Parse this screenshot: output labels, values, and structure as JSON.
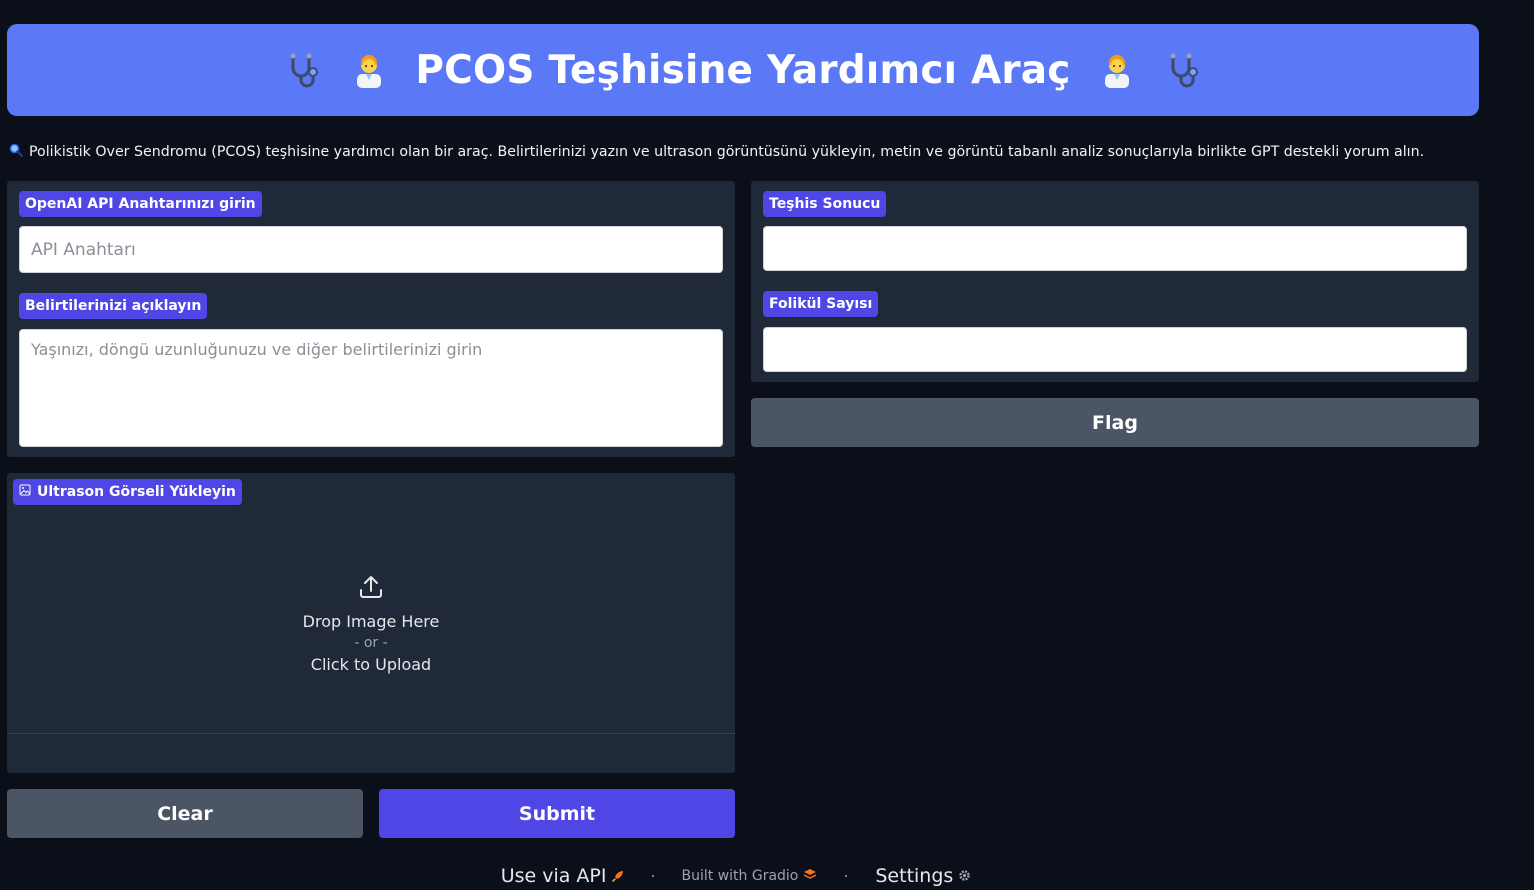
{
  "header": {
    "title": "PCOS Teşhisine Yardımcı Araç",
    "icons": [
      "stethoscope-icon",
      "health-worker-icon",
      "health-worker-icon",
      "stethoscope-icon"
    ]
  },
  "description": {
    "icon": "magnifier-icon",
    "text": "Polikistik Over Sendromu (PCOS) teşhisine yardımcı olan bir araç. Belirtilerinizi yazın ve ultrason görüntüsünü yükleyin, metin ve görüntü tabanlı analiz sonuçlarıyla birlikte GPT destekli yorum alın."
  },
  "inputs": {
    "api_key": {
      "label": "OpenAI API Anahtarınızı girin",
      "placeholder": "API Anahtarı",
      "value": ""
    },
    "symptoms": {
      "label": "Belirtilerinizi açıklayın",
      "placeholder": "Yaşınızı, döngü uzunluğunuzu ve diğer belirtilerinizi girin",
      "value": ""
    },
    "image": {
      "label": "Ultrason Görseli Yükleyin",
      "label_icon": "image-icon",
      "upload_icon": "upload-icon",
      "drop_text": "Drop Image Here",
      "or_text": "- or -",
      "click_text": "Click to Upload"
    }
  },
  "outputs": {
    "diagnosis": {
      "label": "Teşhis Sonucu",
      "value": ""
    },
    "follicle_count": {
      "label": "Folikül Sayısı",
      "value": ""
    }
  },
  "buttons": {
    "clear": "Clear",
    "submit": "Submit",
    "flag": "Flag"
  },
  "footer": {
    "api": "Use via API",
    "api_icon": "rocket-icon",
    "built_with": "Built with Gradio",
    "gradio_icon": "gradio-logo-icon",
    "settings": "Settings",
    "settings_icon": "gear-icon"
  },
  "colors": {
    "background": "#0b0f19",
    "header": "#5b78f6",
    "panel": "#1f2937",
    "accent": "#4f46e5",
    "secondary_button": "#4b5563"
  }
}
